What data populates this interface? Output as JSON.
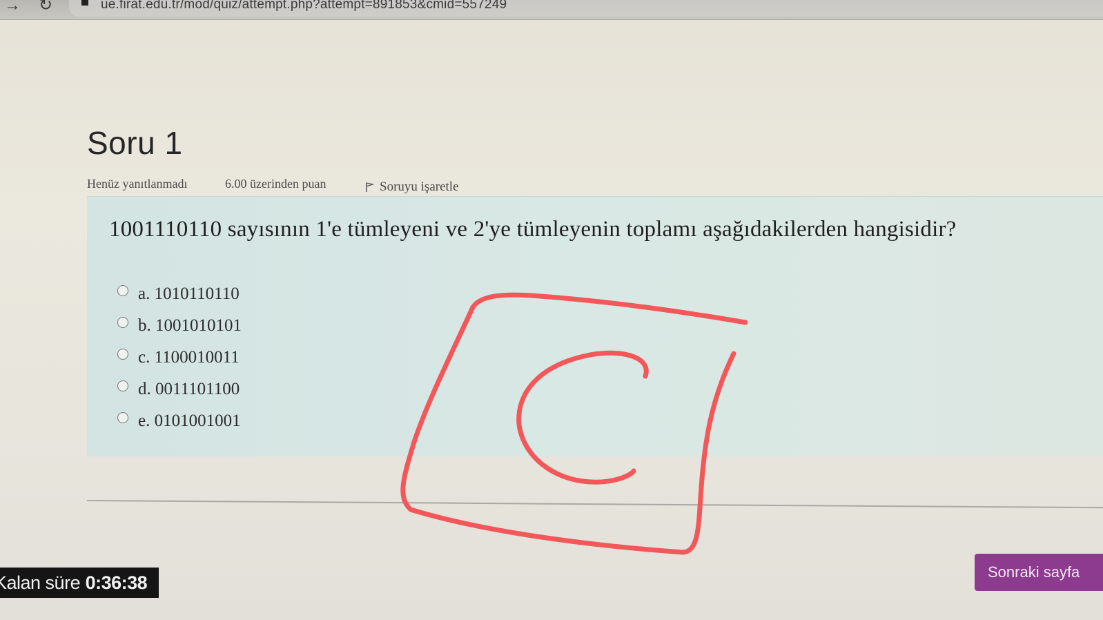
{
  "browser": {
    "url": "ue.firat.edu.tr/mod/quiz/attempt.php?attempt=891853&cmid=557249"
  },
  "question": {
    "title": "Soru 1",
    "status": "Henüz yanıtlanmadı",
    "points": "6.00 üzerinden puan",
    "flag_label": "Soruyu işaretle",
    "text": "1001110110 sayısının 1'e tümleyeni ve 2'ye tümleyenin toplamı aşağıdakilerden hangisidir?",
    "options": [
      {
        "label": "a. 1010110110"
      },
      {
        "label": "b. 1001010101"
      },
      {
        "label": "c. 1100010011"
      },
      {
        "label": "d. 0011101100"
      },
      {
        "label": "e. 0101001001"
      }
    ]
  },
  "timer": {
    "label": "Kalan süre",
    "value": "0:36:38"
  },
  "navigation": {
    "next_label": "Sonraki sayfa"
  },
  "annotation": {
    "handwritten_text": "C",
    "color": "#f2585a"
  },
  "colors": {
    "question_bg": "#d9e8e5",
    "next_button": "#8c3b8e",
    "timer_bg": "#151515"
  }
}
